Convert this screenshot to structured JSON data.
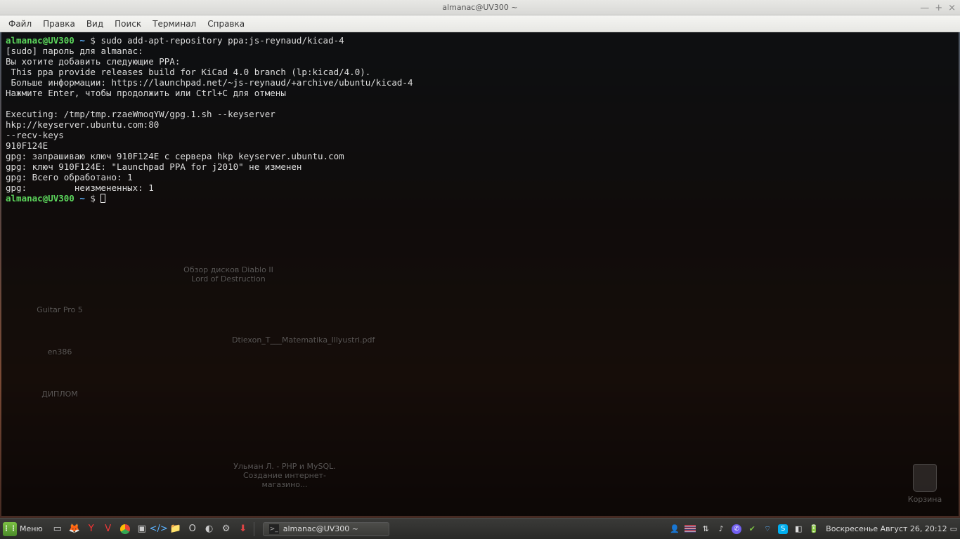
{
  "window": {
    "title": "almanac@UV300 ~"
  },
  "menubar": [
    "Файл",
    "Правка",
    "Вид",
    "Поиск",
    "Терминал",
    "Справка"
  ],
  "prompt": {
    "user_host": "almanac@UV300",
    "path": "~",
    "sep": " $ "
  },
  "terminal": {
    "cmd1": "sudo add-apt-repository ppa:js-reynaud/kicad-4",
    "lines": [
      "[sudo] пароль для almanac: ",
      "Вы хотите добавить следующие PPA:",
      " This ppa provide releases build for KiCad 4.0 branch (lp:kicad/4.0).",
      " Больше информации: https://launchpad.net/~js-reynaud/+archive/ubuntu/kicad-4",
      "Нажмите Enter, чтобы продолжить или Ctrl+C для отмены",
      "",
      "Executing: /tmp/tmp.rzaeWmoqYW/gpg.1.sh --keyserver",
      "hkp://keyserver.ubuntu.com:80",
      "--recv-keys",
      "910F124E",
      "gpg: запрашиваю ключ 910F124E с сервера hkp keyserver.ubuntu.com",
      "gpg: ключ 910F124E: \"Launchpad PPA for j2010\" не изменен",
      "gpg: Всего обработано: 1",
      "gpg:         неизмененных: 1"
    ]
  },
  "desktop_labels": {
    "guitar": "Guitar Pro 5",
    "en386": "en386",
    "diplom": "ДИПЛОМ",
    "diablo": "Обзор дисков Diablo II Lord of Destruction",
    "dtiexon": "Dtiexon_T___Matematika_Illyustri.pdf",
    "ulman": "Ульман Л. - PHP и MySQL. Создание интернет-магазино..."
  },
  "trash": "Корзина",
  "panel": {
    "menu": "Меню",
    "task": "almanac@UV300 ~",
    "clock": "Воскресенье Август 26, 20:12"
  }
}
